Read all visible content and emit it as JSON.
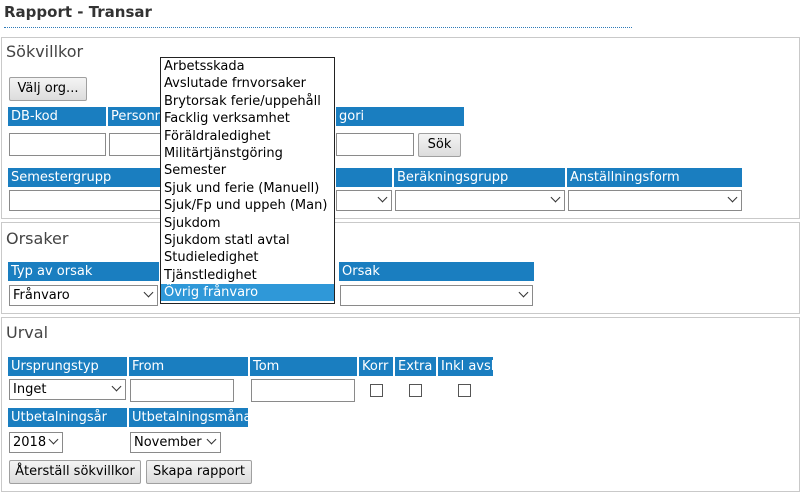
{
  "page": {
    "title": "Rapport - Transar"
  },
  "sokvillkor": {
    "legend": "Sökvillkor",
    "valj_org_label": "Välj org...",
    "headers": {
      "dbkod": "DB-kod",
      "personnr": "Personnr",
      "kategori": "gori"
    },
    "sok_label": "Sök",
    "headers2": {
      "semestergrupp": "Semestergrupp",
      "berakningsgrupp": "Beräkningsgrupp",
      "anstallningsform": "Anställningsform"
    }
  },
  "orsaker": {
    "legend": "Orsaker",
    "typ_header": "Typ av orsak",
    "typ_value": "Frånvaro",
    "orsak_header": "Orsak"
  },
  "urval": {
    "legend": "Urval",
    "headers": {
      "ursprungstyp": "Ursprungstyp",
      "from": "From",
      "tom": "Tom",
      "korr": "Korr",
      "extra": "Extra",
      "inkl_avsl": "Inkl avsl"
    },
    "ursprungstyp_value": "Inget",
    "utb_ar_header": "Utbetalningsår",
    "utb_ar_value": "2018",
    "utb_manad_header": "Utbetalningsmånad",
    "utb_manad_value": "November",
    "reset_label": "Återställ sökvillkor",
    "create_label": "Skapa rapport"
  },
  "dropdown": {
    "options": [
      "Arbetsskada",
      "Avslutade frnvorsaker",
      "Brytorsak ferie/uppehåll",
      "Facklig verksamhet",
      "Föräldraledighet",
      "Militärtjänstgöring",
      "Semester",
      "Sjuk und ferie (Manuell)",
      "Sjuk/Fp und uppeh (Man)",
      "Sjukdom",
      "Sjukdom statl avtal",
      "Studieledighet",
      "Tjänstledighet",
      "Övrig frånvaro"
    ],
    "selected_index": 13
  },
  "colors": {
    "header_bg": "#1a7ec0",
    "selected_bg": "#2f98d8"
  }
}
